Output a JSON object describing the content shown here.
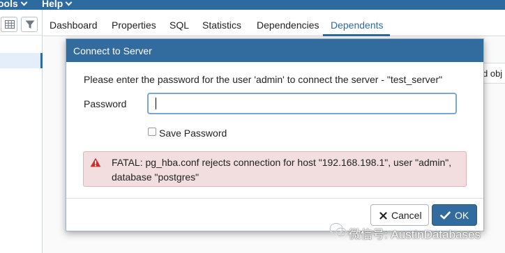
{
  "navbar": {
    "items": [
      {
        "label": "ools"
      },
      {
        "label": "Help"
      }
    ]
  },
  "left_panel": {
    "tools": [
      {
        "icon": "grid-icon"
      },
      {
        "icon": "filter-icon"
      }
    ]
  },
  "tabs": [
    {
      "label": "Dashboard",
      "active": false
    },
    {
      "label": "Properties",
      "active": false
    },
    {
      "label": "SQL",
      "active": false
    },
    {
      "label": "Statistics",
      "active": false
    },
    {
      "label": "Dependencies",
      "active": false
    },
    {
      "label": "Dependents",
      "active": true
    }
  ],
  "main": {
    "background_header": "d obj"
  },
  "dialog": {
    "title": "Connect to Server",
    "prompt": "Please enter the password for the user 'admin' to connect the server - \"test_server\"",
    "password_label": "Password",
    "password_value": "",
    "save_password_label": "Save Password",
    "save_password_checked": false,
    "error": "FATAL: pg_hba.conf rejects connection for host \"192.168.198.1\", user \"admin\", database \"postgres\"",
    "error_icon": "warning-triangle-icon",
    "cancel_label": "Cancel",
    "cancel_icon": "close-icon",
    "ok_label": "OK",
    "ok_icon": "check-icon"
  },
  "watermark": {
    "text": "微信号: AustinDatabases",
    "icon": "wechat-icon"
  },
  "colors": {
    "brand": "#326c9e",
    "navbar": "#2c6aa0",
    "alert_bg": "#f2dede",
    "alert_icon": "#c9302c",
    "input_focus": "#7aa6d6"
  }
}
